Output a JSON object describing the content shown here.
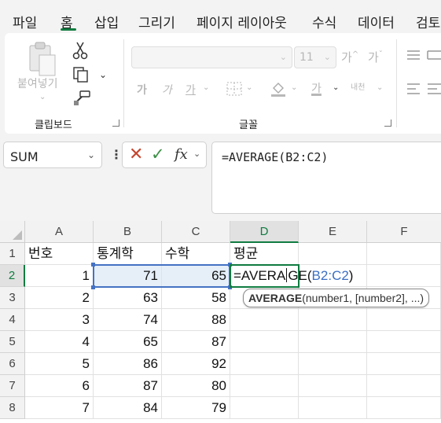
{
  "tabs": [
    "파일",
    "홈",
    "삽입",
    "그리기",
    "페이지 레이아웃",
    "수식",
    "데이터",
    "검토"
  ],
  "ribbon": {
    "clipboard": {
      "label": "클립보드",
      "paste_label": "붙여넣기"
    },
    "font": {
      "label": "글꼴",
      "font_size": "11",
      "grow_label": "가",
      "shrink_label": "가",
      "bold": "가",
      "italic": "가",
      "underline": "가",
      "font_color": "가",
      "phonetic": "내천"
    }
  },
  "formula_bar": {
    "name_box": "SUM",
    "formula": "=AVERAGE(B2:C2)",
    "fx": "fx"
  },
  "columns": [
    "A",
    "B",
    "C",
    "D",
    "E",
    "F"
  ],
  "rows": [
    {
      "num": "1",
      "cells": [
        "번호",
        "통계학",
        "수학",
        "평균"
      ]
    },
    {
      "num": "2",
      "cells": [
        "1",
        "71",
        "65",
        ""
      ]
    },
    {
      "num": "3",
      "cells": [
        "2",
        "63",
        "58",
        ""
      ]
    },
    {
      "num": "4",
      "cells": [
        "3",
        "74",
        "88",
        ""
      ]
    },
    {
      "num": "5",
      "cells": [
        "4",
        "65",
        "87",
        ""
      ]
    },
    {
      "num": "6",
      "cells": [
        "5",
        "86",
        "92",
        ""
      ]
    },
    {
      "num": "7",
      "cells": [
        "6",
        "87",
        "80",
        ""
      ]
    },
    {
      "num": "8",
      "cells": [
        "7",
        "84",
        "79",
        ""
      ]
    }
  ],
  "edit": {
    "prefix": "=AVERA",
    "after_caret": "GE(",
    "ref": "B2:C2",
    "close": ")"
  },
  "tooltip": {
    "function": "AVERAGE",
    "args": "(number1, [number2], ...)"
  },
  "colors": {
    "accent": "#107c41",
    "reference": "#4472c4"
  }
}
